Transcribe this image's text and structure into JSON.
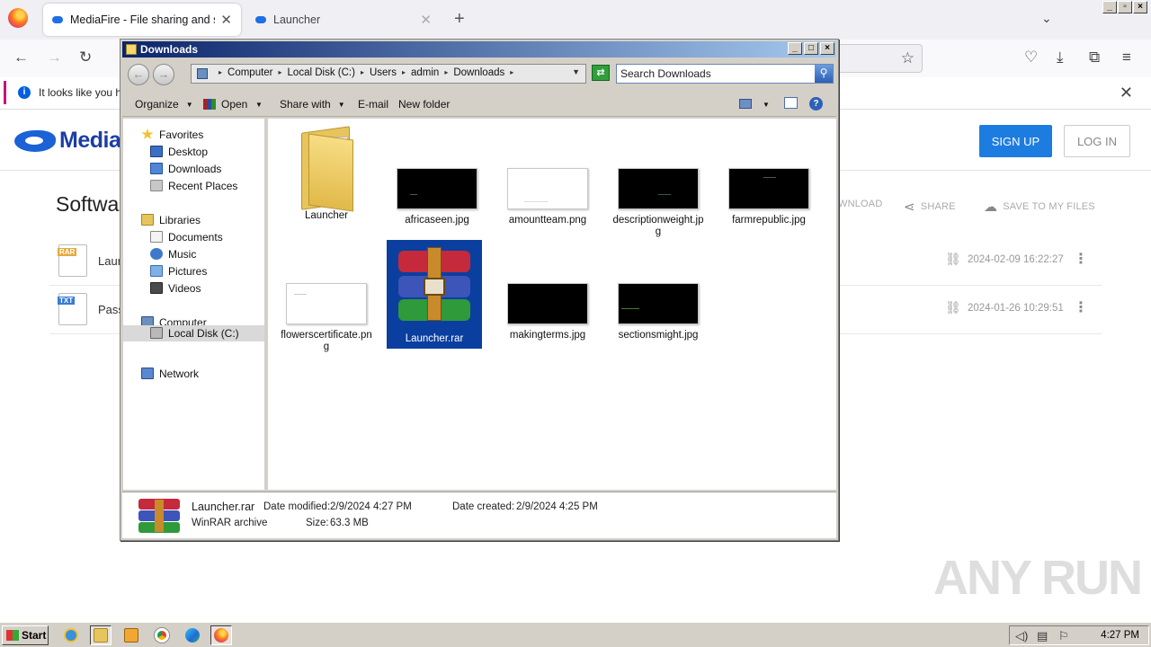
{
  "browser": {
    "tabs": [
      {
        "title": "MediaFire - File sharing and storage",
        "active": true
      },
      {
        "title": "Launcher",
        "active": false
      }
    ],
    "notification": "It looks like you ha"
  },
  "page": {
    "logo_text": "MediaFire",
    "signup_label": "SIGN UP",
    "login_label": "LOG IN",
    "section_title": "Softwa",
    "actions": {
      "download": "WNLOAD",
      "share": "SHARE",
      "save": "SAVE TO MY FILES"
    },
    "files": [
      {
        "type_tag": "RAR",
        "name": "Laur",
        "date": "2024-02-09 16:22:27"
      },
      {
        "type_tag": "TXT",
        "name": "Pass",
        "date": "2024-01-26 10:29:51"
      }
    ],
    "watermark": "ANY RUN"
  },
  "explorer": {
    "title": "Downloads",
    "breadcrumbs": [
      "Computer",
      "Local Disk (C:)",
      "Users",
      "admin",
      "Downloads"
    ],
    "search_placeholder": "Search Downloads",
    "toolbar": {
      "organize": "Organize",
      "open": "Open",
      "share_with": "Share with",
      "email": "E-mail",
      "new_folder": "New folder"
    },
    "nav": {
      "favorites": "Favorites",
      "desktop": "Desktop",
      "downloads": "Downloads",
      "recent": "Recent Places",
      "libraries": "Libraries",
      "documents": "Documents",
      "music": "Music",
      "pictures": "Pictures",
      "videos": "Videos",
      "computer": "Computer",
      "local_disk": "Local Disk (C:)",
      "network": "Network"
    },
    "items": [
      {
        "name": "Launcher",
        "kind": "folder"
      },
      {
        "name": "africaseen.jpg",
        "kind": "dark"
      },
      {
        "name": "amountteam.png",
        "kind": "light"
      },
      {
        "name": "descriptionweight.jpg",
        "kind": "dark"
      },
      {
        "name": "farmrepublic.jpg",
        "kind": "dark"
      },
      {
        "name": "flowerscertificate.png",
        "kind": "light"
      },
      {
        "name": "Launcher.rar",
        "kind": "rar",
        "selected": true
      },
      {
        "name": "makingterms.jpg",
        "kind": "dark"
      },
      {
        "name": "sectionsmight.jpg",
        "kind": "dark"
      }
    ],
    "details": {
      "name": "Launcher.rar",
      "type": "WinRAR archive",
      "modified_label": "Date modified:",
      "modified": "2/9/2024 4:27 PM",
      "created_label": "Date created:",
      "created": "2/9/2024 4:25 PM",
      "size_label": "Size:",
      "size": "63.3 MB"
    }
  },
  "taskbar": {
    "start_label": "Start",
    "clock": "4:27 PM"
  }
}
